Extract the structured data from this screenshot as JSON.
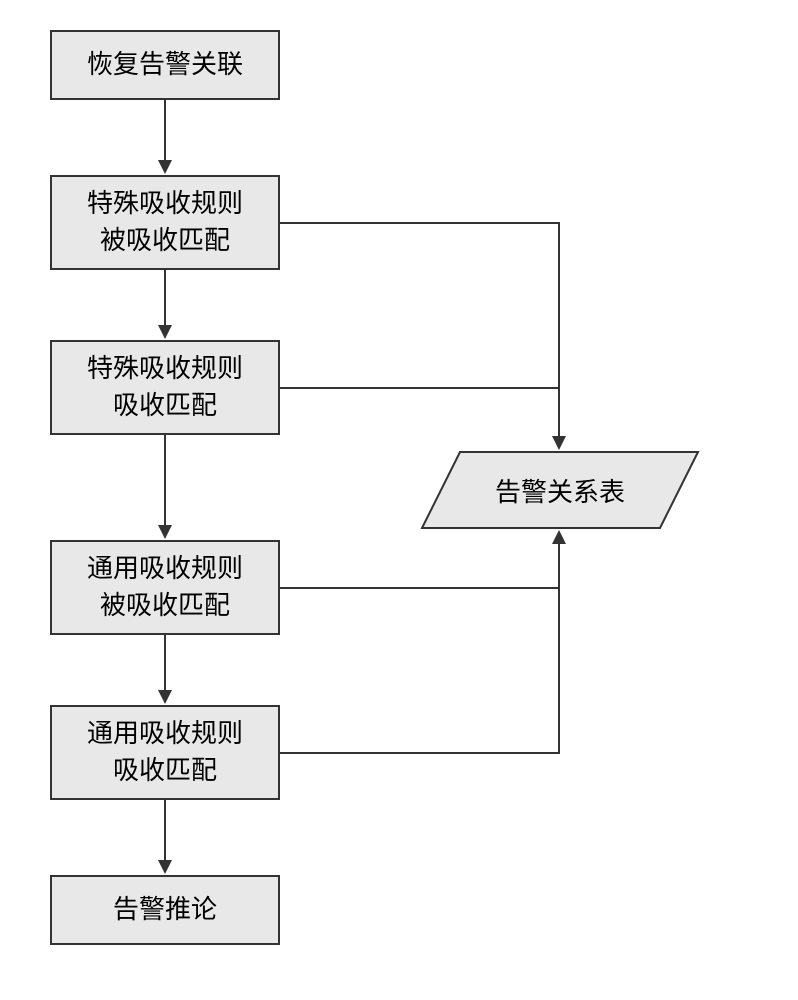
{
  "boxes": {
    "box1": "恢复告警关联",
    "box2": "特殊吸收规则\n被吸收匹配",
    "box3": "特殊吸收规则\n吸收匹配",
    "box4": "通用吸收规则\n被吸收匹配",
    "box5": "通用吸收规则\n吸收匹配",
    "box6": "告警推论",
    "side": "告警关系表"
  }
}
